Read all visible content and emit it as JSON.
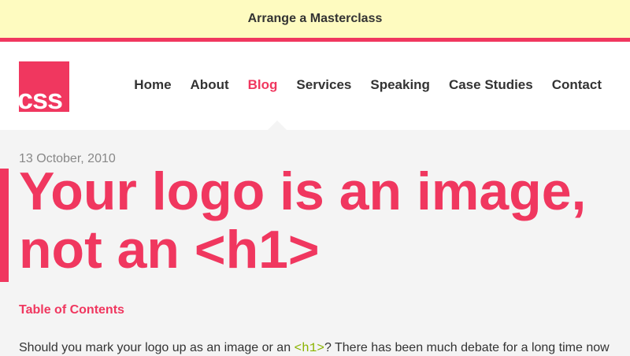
{
  "banner": {
    "link_label": "Arrange a Masterclass"
  },
  "header": {
    "logo_text": "css",
    "nav": [
      {
        "label": "Home",
        "active": false
      },
      {
        "label": "About",
        "active": false
      },
      {
        "label": "Blog",
        "active": true
      },
      {
        "label": "Services",
        "active": false
      },
      {
        "label": "Speaking",
        "active": false
      },
      {
        "label": "Case Studies",
        "active": false
      },
      {
        "label": "Contact",
        "active": false
      }
    ]
  },
  "post": {
    "date": "13 October, 2010",
    "title": "Your logo is an image, not an <h1>",
    "toc_label": "Table of Contents",
    "intro_before": "Should you mark your logo up as an image or an ",
    "intro_code": "<h1>",
    "intro_after": "? There has been much debate for a long time now"
  },
  "colors": {
    "accent": "#f0375f",
    "banner_bg": "#fefbc0",
    "text": "#333333",
    "muted": "#888888",
    "code": "#8bb300",
    "page_bg": "#f4f4f4"
  }
}
